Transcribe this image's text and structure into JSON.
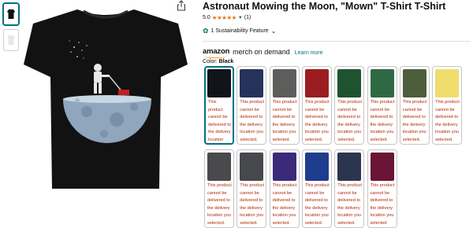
{
  "product": {
    "title": "Astronaut Mowing the Moon, \"Mown\" T-Shirt T-Shirt",
    "rating_value": "5.0",
    "stars": "★★★★★",
    "rating_count": "(1)",
    "sustainability_label": "1 Sustainability Feature"
  },
  "brand": {
    "amazon": "amazon",
    "merch": "merch on demand",
    "learn_more": "Learn more"
  },
  "color": {
    "label": "Color: ",
    "selected": "Black"
  },
  "swatches": [
    {
      "hex": "#111418",
      "msg": "This product cannot be delivered to the delivery location you selected."
    },
    {
      "hex": "#27325b",
      "msg": "This product cannot be delivered to the delivery location you selected."
    },
    {
      "hex": "#5d5d5b",
      "msg": "This product cannot be delivered to the delivery location you selected."
    },
    {
      "hex": "#9c1d20",
      "msg": "This product cannot be delivered to the delivery location you selected."
    },
    {
      "hex": "#1f5330",
      "msg": "This product cannot be delivered to the delivery location you selected."
    },
    {
      "hex": "#2f6944",
      "msg": "This product cannot be delivered to the delivery location you selected."
    },
    {
      "hex": "#4d5e3d",
      "msg": "This product cannot be delivered to the delivery location you selected."
    },
    {
      "hex": "#f0dd6e",
      "msg": "This product cannot be delivered to the delivery location you selected."
    },
    {
      "hex": "#4a4a4c",
      "msg": "This product cannot be delivered to the delivery location you selected."
    },
    {
      "hex": "#47484c",
      "msg": "This product cannot be delivered to the delivery location you selected."
    },
    {
      "hex": "#3b2a7a",
      "msg": "This product cannot be delivered to the delivery location you selected."
    },
    {
      "hex": "#1f3d8e",
      "msg": "This product cannot be delivered to the delivery location you selected."
    },
    {
      "hex": "#2b3550",
      "msg": "This product cannot be delivered to the delivery location you selected."
    },
    {
      "hex": "#6a1535",
      "msg": "This product cannot be delivered to the delivery location you selected."
    }
  ],
  "accent": "#007185",
  "star_color": "#de7921",
  "error_color": "#b12704"
}
